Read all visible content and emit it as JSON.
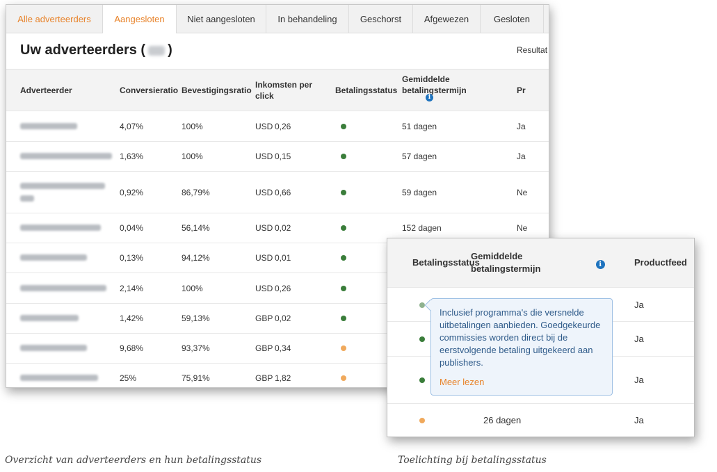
{
  "tabs": [
    {
      "label": "Alle adverteerders"
    },
    {
      "label": "Aangesloten"
    },
    {
      "label": "Niet aangesloten"
    },
    {
      "label": "In behandeling"
    },
    {
      "label": "Geschorst"
    },
    {
      "label": "Afgewezen"
    },
    {
      "label": "Gesloten"
    }
  ],
  "page": {
    "title_prefix": "Uw adverteerders (",
    "title_suffix": ")",
    "results_label": "Resultat"
  },
  "table": {
    "headers": {
      "advertiser": "Adverteerder",
      "conversion": "Conversieratio",
      "confirmation": "Bevestigingsratio",
      "income": "Inkomsten per click",
      "payment_status": "Betalingsstatus",
      "avg_term": "Gemiddelde betalingstermijn",
      "feed": "Pr"
    },
    "rows": [
      {
        "conversion": "4,07%",
        "confirmation": "100%",
        "currency": "USD",
        "income": "0,26",
        "status_color": "#3a7d3a",
        "term": "51 dagen",
        "feed": "Ja"
      },
      {
        "conversion": "1,63%",
        "confirmation": "100%",
        "currency": "USD",
        "income": "0,15",
        "status_color": "#3a7d3a",
        "term": "57 dagen",
        "feed": "Ja"
      },
      {
        "conversion": "0,92%",
        "confirmation": "86,79%",
        "currency": "USD",
        "income": "0,66",
        "status_color": "#3a7d3a",
        "term": "59 dagen",
        "feed": "Ne"
      },
      {
        "conversion": "0,04%",
        "confirmation": "56,14%",
        "currency": "USD",
        "income": "0,02",
        "status_color": "#3a7d3a",
        "term": "152 dagen",
        "feed": "Ne"
      },
      {
        "conversion": "0,13%",
        "confirmation": "94,12%",
        "currency": "USD",
        "income": "0,01",
        "status_color": "#3a7d3a",
        "term": "",
        "feed": ""
      },
      {
        "conversion": "2,14%",
        "confirmation": "100%",
        "currency": "USD",
        "income": "0,26",
        "status_color": "#3a7d3a",
        "term": "",
        "feed": ""
      },
      {
        "conversion": "1,42%",
        "confirmation": "59,13%",
        "currency": "GBP",
        "income": "0,02",
        "status_color": "#3a7d3a",
        "term": "",
        "feed": ""
      },
      {
        "conversion": "9,68%",
        "confirmation": "93,37%",
        "currency": "GBP",
        "income": "0,34",
        "status_color": "#f0a95c",
        "term": "",
        "feed": ""
      },
      {
        "conversion": "25%",
        "confirmation": "75,91%",
        "currency": "GBP",
        "income": "1,82",
        "status_color": "#f0a95c",
        "term": "",
        "feed": ""
      }
    ]
  },
  "zoom": {
    "headers": {
      "payment_status": "Betalingsstatus",
      "avg_term": "Gemiddelde betalingstermijn",
      "feed": "Productfeed"
    },
    "rows": [
      {
        "status_color": "#8fb28f",
        "term": "",
        "feed": "Ja"
      },
      {
        "status_color": "#3a7d3a",
        "term": "",
        "feed": "Ja"
      },
      {
        "status_color": "#3a7d3a",
        "term": "",
        "feed": "Ja"
      },
      {
        "status_color": "#f0a95c",
        "term": "26 dagen",
        "feed": "Ja"
      }
    ],
    "tooltip": {
      "text": "Inclusief programma's die versnelde uitbetalingen aanbieden. Goedgekeurde commissies worden direct bij de eerstvolgende betaling uitgekeerd aan publishers.",
      "link": "Meer lezen"
    }
  },
  "captions": {
    "left": "Overzicht van adverteerders en hun betalingsstatus",
    "right": "Toelichting bij betalingsstatus"
  },
  "colors": {
    "accent": "#e8832a",
    "status_green": "#3a7d3a",
    "status_orange": "#f0a95c",
    "info_blue": "#1e73be"
  }
}
